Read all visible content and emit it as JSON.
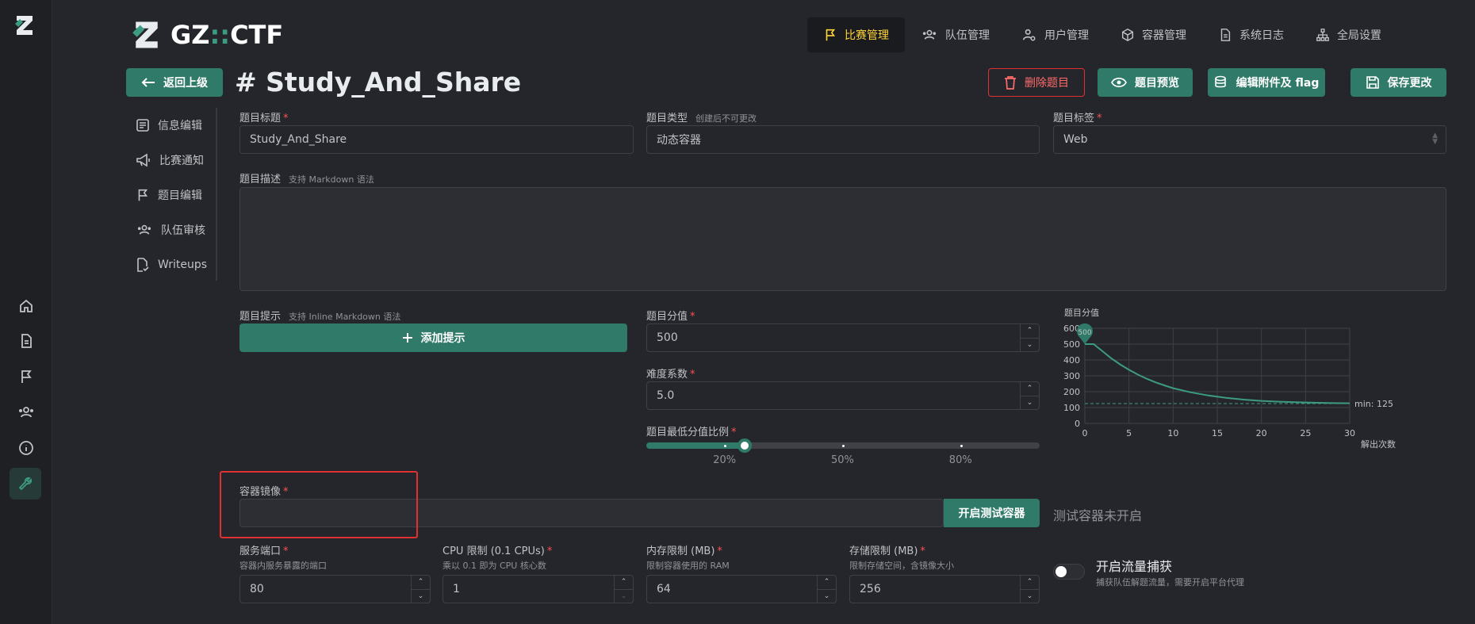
{
  "brand": {
    "name_prefix": "GZ",
    "name_sep": "::",
    "name_suffix": "CTF"
  },
  "topnav": [
    {
      "label": "比赛管理",
      "icon": "flag-icon",
      "active": true
    },
    {
      "label": "队伍管理",
      "icon": "users-icon"
    },
    {
      "label": "用户管理",
      "icon": "user-cog-icon"
    },
    {
      "label": "容器管理",
      "icon": "cube-icon"
    },
    {
      "label": "系统日志",
      "icon": "file-text-icon"
    },
    {
      "label": "全局设置",
      "icon": "sitemap-icon"
    }
  ],
  "back_button": "返回上级",
  "page_title": "# Study_And_Share",
  "actions": {
    "delete": "删除题目",
    "preview": "题目预览",
    "edit_attachments": "编辑附件及 flag",
    "save": "保存更改"
  },
  "sidenav": [
    {
      "label": "信息编辑",
      "icon": "info-edit-icon"
    },
    {
      "label": "比赛通知",
      "icon": "speaker-icon"
    },
    {
      "label": "题目编辑",
      "icon": "flag-icon",
      "active": true
    },
    {
      "label": "队伍审核",
      "icon": "users-icon"
    },
    {
      "label": "Writeups",
      "icon": "file-check-icon"
    }
  ],
  "form": {
    "title": {
      "label": "题目标题",
      "value": "Study_And_Share"
    },
    "type": {
      "label": "题目类型",
      "hint": "创建后不可更改",
      "value": "动态容器"
    },
    "tag": {
      "label": "题目标签",
      "value": "Web"
    },
    "description": {
      "label": "题目描述",
      "hint": "支持 Markdown 语法",
      "value": ""
    },
    "hints": {
      "label": "题目提示",
      "hint": "支持 Inline Markdown 语法",
      "add_button": "添加提示"
    },
    "score": {
      "label": "题目分值",
      "value": "500"
    },
    "difficulty": {
      "label": "难度系数",
      "value": "5.0"
    },
    "min_ratio": {
      "label": "题目最低分值比例",
      "value": 0.25,
      "marks": [
        "20%",
        "50%",
        "80%"
      ],
      "mark_values": [
        0.2,
        0.5,
        0.8
      ]
    },
    "image": {
      "label": "容器镜像",
      "value": "",
      "test_button": "开启测试容器",
      "test_status": "测试容器未开启"
    },
    "port": {
      "label": "服务端口",
      "sub": "容器内服务暴露的端口",
      "value": "80"
    },
    "cpu": {
      "label": "CPU 限制 (0.1 CPUs)",
      "sub": "乘以 0.1 即为 CPU 核心数",
      "value": "1"
    },
    "memory": {
      "label": "内存限制 (MB)",
      "sub": "限制容器使用的 RAM",
      "value": "64"
    },
    "storage": {
      "label": "存储限制 (MB)",
      "sub": "限制存储空间，含镜像大小",
      "value": "256"
    },
    "capture": {
      "label": "开启流量捕获",
      "sub": "捕获队伍解题流量，需要开启平台代理",
      "enabled": false
    }
  },
  "chart_data": {
    "type": "line",
    "title": "题目分值",
    "xlabel": "解出次数",
    "ylabel": "",
    "xlim": [
      0,
      30
    ],
    "ylim": [
      0,
      600
    ],
    "xticks": [
      0,
      5,
      10,
      15,
      20,
      25,
      30
    ],
    "yticks": [
      0,
      100,
      200,
      300,
      400,
      500,
      600
    ],
    "grid": true,
    "series": [
      {
        "x": [
          0,
          1,
          2,
          3,
          4,
          5,
          6,
          7,
          8,
          9,
          10,
          12,
          14,
          16,
          18,
          20,
          22,
          25,
          28,
          30
        ],
        "y": [
          500,
          500,
          455,
          410,
          372,
          338,
          308,
          282,
          259,
          240,
          222,
          196,
          176,
          161,
          150,
          142,
          137,
          132,
          128,
          127
        ]
      }
    ],
    "max_marker": {
      "x": 0,
      "y": 500,
      "label": "500"
    },
    "min_line": {
      "y": 125,
      "label": "min: 125"
    }
  },
  "colors": {
    "accent": "#2f7a68",
    "danger": "#e03131",
    "active_nav": "#ffd43b",
    "line": "#3c9b83"
  }
}
